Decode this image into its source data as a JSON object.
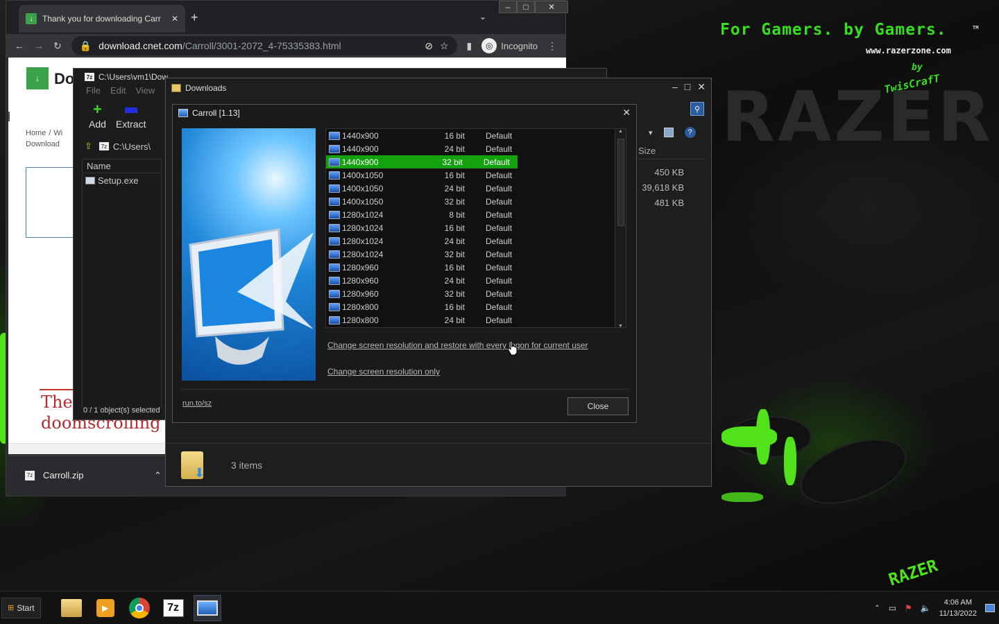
{
  "desktop": {
    "tagline": "For Gamers. by Gamers.",
    "tm": "TM",
    "site": "www.razerzone.com",
    "by": "by",
    "signature": "TwisCrafT",
    "brand": "RAZER",
    "brand_small": "RAZER"
  },
  "browser": {
    "tab_title": "Thank you for downloading Carr",
    "tab_close": "✕",
    "new_tab": "+",
    "url_host": "download.cnet.com",
    "url_path": "/Carroll/3001-2072_4-75335383.html",
    "incognito_label": "Incognito",
    "page_logo": "Do",
    "breadcrumb_home": "Home",
    "breadcrumb_sep": "/",
    "breadcrumb_win": "Wi",
    "breadcrumb_download": "Download",
    "headline_line1": "The",
    "headline_line2": "doomscrolling",
    "download_file": "Carroll.zip"
  },
  "sevenzip": {
    "title": "C:\\Users\\vm1\\Dow",
    "menu": [
      "File",
      "Edit",
      "View"
    ],
    "add_label": "Add",
    "extract_label": "Extract",
    "path": "C:\\Users\\",
    "column_name": "Name",
    "file": "Setup.exe",
    "status": "0 / 1 object(s) selected"
  },
  "downloads": {
    "title": "Downloads",
    "column_size": "Size",
    "sizes": [
      "450 KB",
      "39,618 KB",
      "481 KB"
    ],
    "status_items": "3 items"
  },
  "carroll": {
    "title": "Carroll [1.13]",
    "rows": [
      {
        "res": "1440x900",
        "bit": "16 bit",
        "def": "Default",
        "selected": false
      },
      {
        "res": "1440x900",
        "bit": "24 bit",
        "def": "Default",
        "selected": false
      },
      {
        "res": "1440x900",
        "bit": "32 bit",
        "def": "Default",
        "selected": true
      },
      {
        "res": "1400x1050",
        "bit": "16 bit",
        "def": "Default",
        "selected": false
      },
      {
        "res": "1400x1050",
        "bit": "24 bit",
        "def": "Default",
        "selected": false
      },
      {
        "res": "1400x1050",
        "bit": "32 bit",
        "def": "Default",
        "selected": false
      },
      {
        "res": "1280x1024",
        "bit": "8 bit",
        "def": "Default",
        "selected": false
      },
      {
        "res": "1280x1024",
        "bit": "16 bit",
        "def": "Default",
        "selected": false
      },
      {
        "res": "1280x1024",
        "bit": "24 bit",
        "def": "Default",
        "selected": false
      },
      {
        "res": "1280x1024",
        "bit": "32 bit",
        "def": "Default",
        "selected": false
      },
      {
        "res": "1280x960",
        "bit": "16 bit",
        "def": "Default",
        "selected": false
      },
      {
        "res": "1280x960",
        "bit": "24 bit",
        "def": "Default",
        "selected": false
      },
      {
        "res": "1280x960",
        "bit": "32 bit",
        "def": "Default",
        "selected": false
      },
      {
        "res": "1280x800",
        "bit": "16 bit",
        "def": "Default",
        "selected": false
      },
      {
        "res": "1280x800",
        "bit": "24 bit",
        "def": "Default",
        "selected": false
      }
    ],
    "link_restore": "Change screen resolution and restore with every logon for current user",
    "link_only": "Change screen resolution only",
    "footer_link": "run.to/sz",
    "close_button": "Close",
    "selection_color": "#13a10e"
  },
  "taskbar": {
    "start": "Start",
    "time": "4:06 AM",
    "date": "11/13/2022"
  }
}
